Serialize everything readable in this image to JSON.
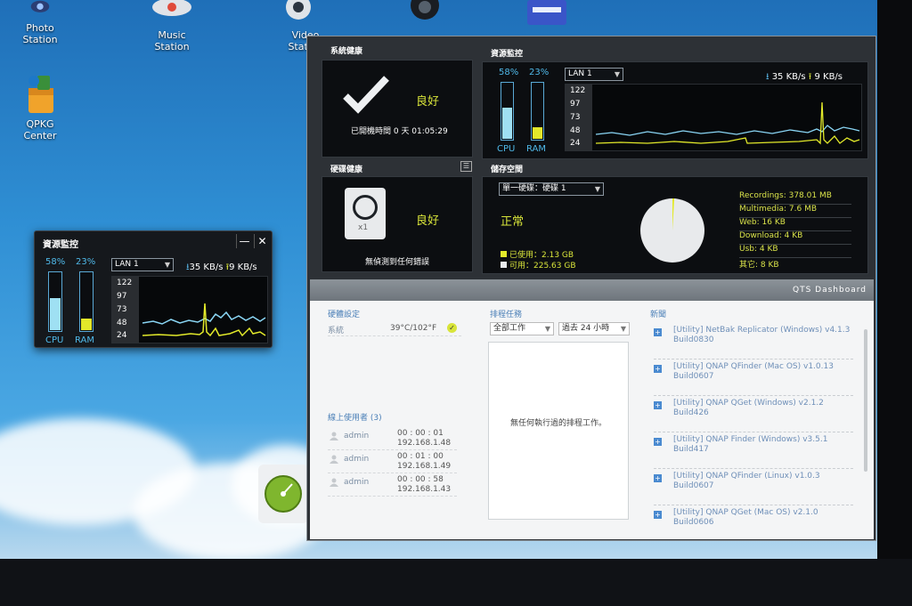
{
  "desktop": {
    "icons": [
      {
        "label": "Photo\nStation",
        "icon": "photo-station-icon"
      },
      {
        "label": "Music\nStation",
        "icon": "music-station-icon"
      },
      {
        "label": "Video\nStation",
        "icon": "video-station-icon"
      },
      {
        "label": "QPKG\nCenter",
        "icon": "qpkg-center-icon"
      }
    ],
    "icon_labels": {
      "photo": "Photo",
      "photo2": "Station",
      "music": "Music",
      "music2": "Station",
      "video": "Video",
      "video2": "Station",
      "qpkg": "QPKG",
      "qpkg2": "Center"
    }
  },
  "mini_widget": {
    "title": "資源監控",
    "cpu_pct": "58%",
    "ram_pct": "23%",
    "cpu_level": 0.58,
    "ram_level": 0.23,
    "cpu_label": "CPU",
    "ram_label": "RAM",
    "lan": "LAN 1",
    "down_speed": "35 KB/s",
    "up_speed": "9 KB/s",
    "ticks": [
      "122",
      "97",
      "73",
      "48",
      "24"
    ]
  },
  "dashboard": {
    "health": {
      "title": "系統健康",
      "status": "良好",
      "uptime": "已開機時間 0 天 01:05:29"
    },
    "disk": {
      "title": "硬碟健康",
      "status": "良好",
      "count": "x1",
      "note": "無偵測到任何錯誤"
    },
    "resource": {
      "title": "資源監控",
      "cpu_pct": "58%",
      "ram_pct": "23%",
      "cpu_level": 0.58,
      "ram_level": 0.23,
      "cpu_label": "CPU",
      "ram_label": "RAM",
      "lan": "LAN 1",
      "down_speed": "35 KB/s",
      "up_speed": "9 KB/s",
      "ticks": [
        "122",
        "97",
        "73",
        "48",
        "24"
      ]
    },
    "storage": {
      "title": "儲存空間",
      "volume_select": "單一硬碟：硬碟 1",
      "status": "正常",
      "used": "已使用：2.13 GB",
      "free": "可用：225.63 GB",
      "used_fraction": 0.0093,
      "legend": [
        "Recordings: 378.01 MB",
        "Multimedia: 7.6 MB",
        "Web: 16 KB",
        "Download: 4 KB",
        "Usb: 4 KB",
        "其它: 8 KB"
      ]
    },
    "lower": {
      "bar_label": "QTS  Dashboard",
      "hw": {
        "title": "硬體設定",
        "label": "系統",
        "temp": "39°C/102°F"
      },
      "online": {
        "title": "線上使用者 (3)",
        "users": [
          {
            "name": "admin",
            "time": "00 : 00 : 01",
            "ip": "192.168.1.48"
          },
          {
            "name": "admin",
            "time": "00 : 01 : 00",
            "ip": "192.168.1.49"
          },
          {
            "name": "admin",
            "time": "00 : 00 : 58",
            "ip": "192.168.1.43"
          }
        ]
      },
      "tasks": {
        "title": "排程任務",
        "filter": "全部工作",
        "range": "過去 24 小時",
        "empty": "無任何執行過的排程工作。"
      },
      "news": {
        "title": "新聞",
        "items": [
          {
            "line1": "[Utility] NetBak Replicator (Windows) v4.1.3",
            "line2": "Build0830"
          },
          {
            "line1": "[Utility] QNAP QFinder (Mac OS) v1.0.13",
            "line2": "Build0607"
          },
          {
            "line1": "[Utility] QNAP QGet (Windows) v2.1.2",
            "line2": "Build426"
          },
          {
            "line1": "[Utility] QNAP Finder (Windows) v3.5.1",
            "line2": "Build417"
          },
          {
            "line1": "[Utility] QNAP QFinder (Linux) v1.0.3",
            "line2": "Build0607"
          },
          {
            "line1": "[Utility] QNAP QGet (Mac OS) v2.1.0",
            "line2": "Build0606"
          }
        ]
      }
    }
  },
  "colors": {
    "accent_yellow": "#d8e43a",
    "accent_blue": "#5ab9ea",
    "link_blue": "#4a7fb7"
  }
}
